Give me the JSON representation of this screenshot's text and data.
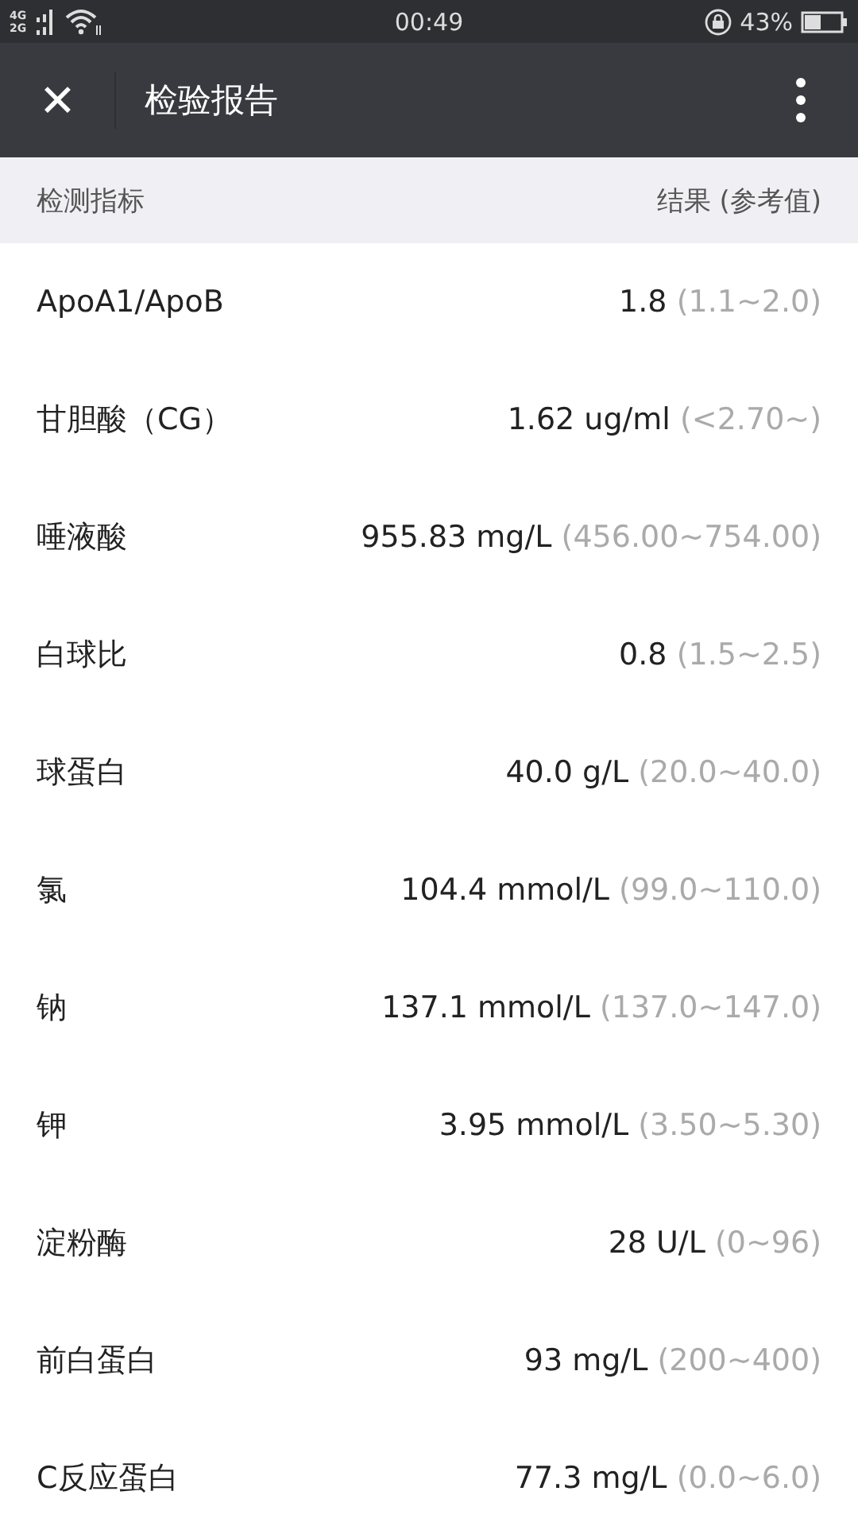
{
  "status_bar": {
    "network": "4G 2G",
    "time": "00:49",
    "battery": "43%"
  },
  "header": {
    "close": "✕",
    "title": "检验报告"
  },
  "table": {
    "columns": [
      "检测指标",
      "结果 (参考值)"
    ],
    "rows": [
      {
        "name": "ApoA1/ApoB",
        "value": "1.8",
        "reference": "(1.1~2.0)"
      },
      {
        "name": "甘胆酸（CG）",
        "value": "1.62 ug/ml",
        "reference": "(<2.70~)"
      },
      {
        "name": "唾液酸",
        "value": "955.83 mg/L",
        "reference": "(456.00~754.00)"
      },
      {
        "name": "白球比",
        "value": "0.8",
        "reference": "(1.5~2.5)"
      },
      {
        "name": "球蛋白",
        "value": "40.0 g/L",
        "reference": "(20.0~40.0)"
      },
      {
        "name": "氯",
        "value": "104.4 mmol/L",
        "reference": "(99.0~110.0)"
      },
      {
        "name": "钠",
        "value": "137.1 mmol/L",
        "reference": "(137.0~147.0)"
      },
      {
        "name": "钾",
        "value": "3.95 mmol/L",
        "reference": "(3.50~5.30)"
      },
      {
        "name": "淀粉酶",
        "value": "28 U/L",
        "reference": "(0~96)"
      },
      {
        "name": "前白蛋白",
        "value": "93 mg/L",
        "reference": "(200~400)"
      },
      {
        "name": "C反应蛋白",
        "value": "77.3 mg/L",
        "reference": "(0.0~6.0)"
      }
    ]
  }
}
